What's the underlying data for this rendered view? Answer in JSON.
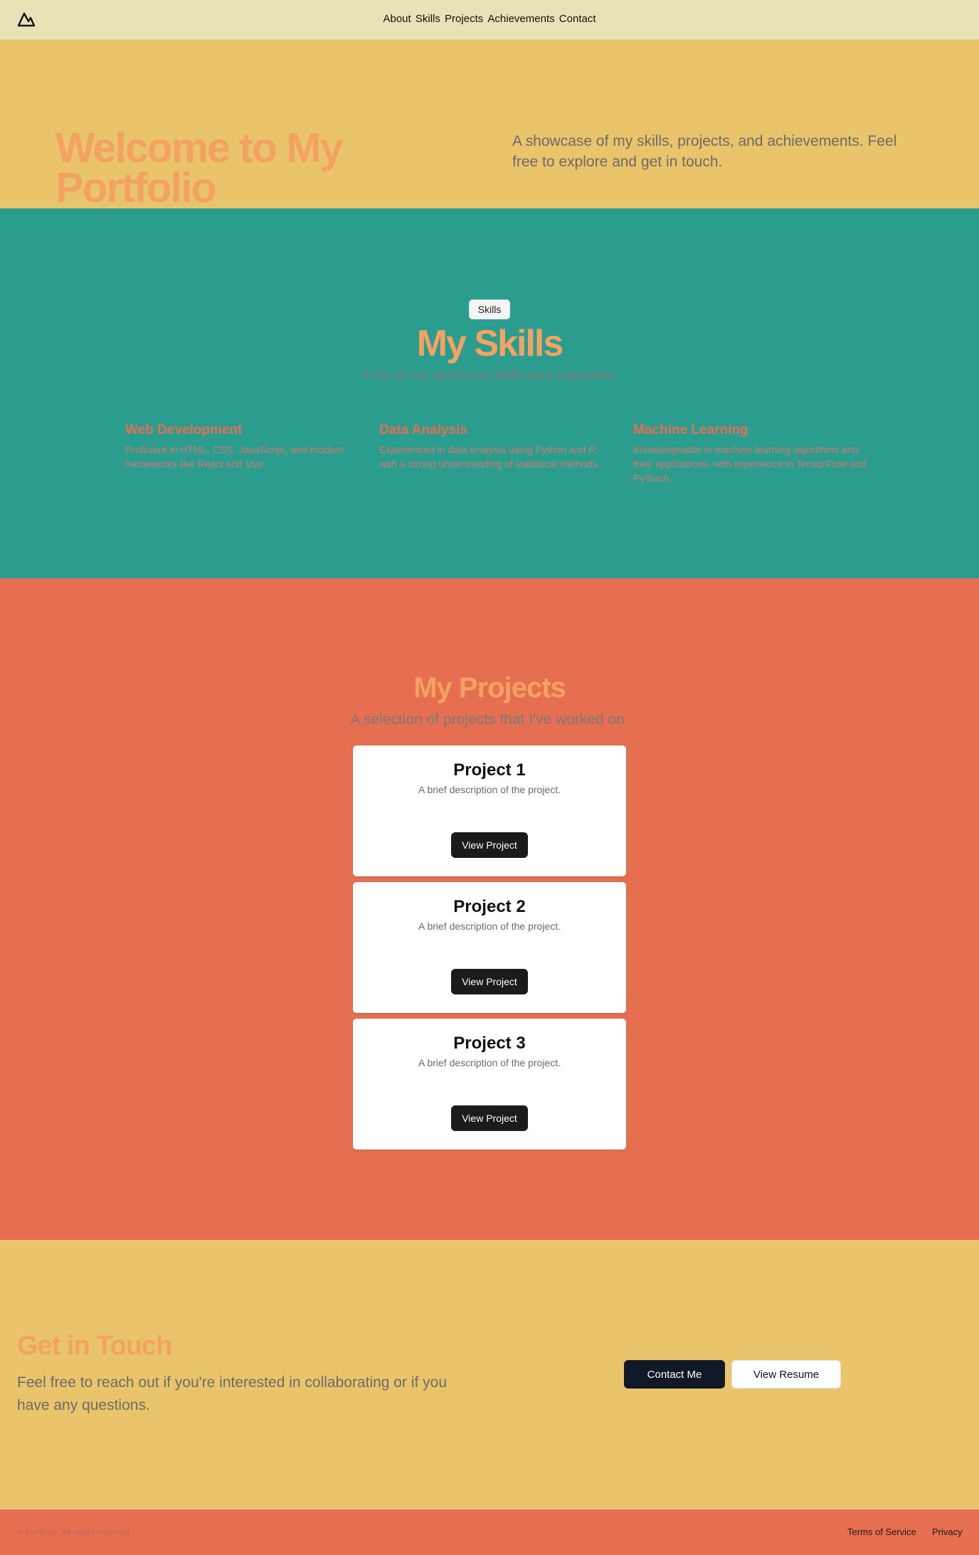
{
  "nav": {
    "items": [
      "About",
      "Skills",
      "Projects",
      "Achievements",
      "Contact"
    ]
  },
  "hero": {
    "title": "Welcome to My Portfolio",
    "text": "A showcase of my skills, projects, and achievements. Feel free to explore and get in touch."
  },
  "skills": {
    "badge": "Skills",
    "title": "My Skills",
    "subtitle": "A list of my technical skills and expertise.",
    "items": [
      {
        "title": "Web Development",
        "desc": "Proficient in HTML, CSS, JavaScript, and modern frameworks like React and Vue."
      },
      {
        "title": "Data Analysis",
        "desc": "Experienced in data analysis using Python and R, with a strong understanding of statistical methods."
      },
      {
        "title": "Machine Learning",
        "desc": "Knowledgeable in machine learning algorithms and their applications, with experience in TensorFlow and PyTorch."
      }
    ]
  },
  "projects": {
    "title": "My Projects",
    "subtitle": "A selection of projects that I've worked on.",
    "items": [
      {
        "title": "Project 1",
        "desc": "A brief description of the project.",
        "button": "View Project"
      },
      {
        "title": "Project 2",
        "desc": "A brief description of the project.",
        "button": "View Project"
      },
      {
        "title": "Project 3",
        "desc": "A brief description of the project.",
        "button": "View Project"
      }
    ]
  },
  "contact": {
    "title": "Get in Touch",
    "text": "Feel free to reach out if you're interested in collaborating or if you have any questions.",
    "primary_button": "Contact Me",
    "secondary_button": "View Resume"
  },
  "footer": {
    "copyright": "© Portfolio. All rights reserved.",
    "links": [
      "Terms of Service",
      "Privacy"
    ]
  },
  "colors": {
    "header_bg": "#e9e2b6",
    "yellow": "#e9c46a",
    "teal": "#2a9d8f",
    "coral": "#e76f51",
    "orange_accent": "#f4a261"
  },
  "icons": {
    "logo": "mountain-icon"
  }
}
